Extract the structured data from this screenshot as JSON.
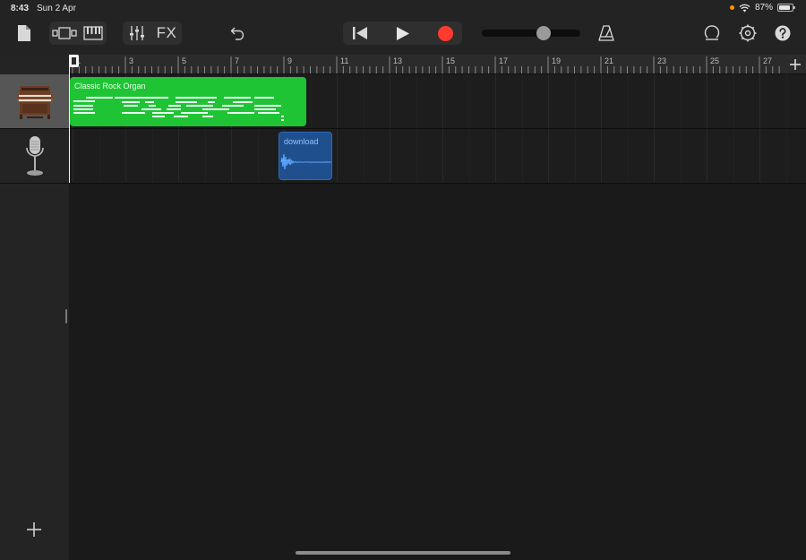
{
  "status_bar": {
    "time": "8:43",
    "date": "Sun 2 Apr",
    "battery": "87%",
    "battery_level": 0.87
  },
  "toolbar": {
    "fx_label": "FX",
    "icons": [
      "document-icon",
      "track-view-icon",
      "keyboard-icon",
      "mixer-icon",
      "undo-icon",
      "go-to-beginning-icon",
      "play-icon",
      "record-icon",
      "metronome-icon",
      "loop-browser-icon",
      "settings-icon",
      "help-icon"
    ],
    "tempo_slider_value": 0.65,
    "record_color": "#ff3b30"
  },
  "ruler": {
    "bar_labels": [
      "1",
      "3",
      "5",
      "7",
      "9",
      "11",
      "13",
      "15",
      "17",
      "19",
      "21",
      "23",
      "25",
      "27"
    ]
  },
  "tracks": [
    {
      "instrument": "organ",
      "icon": "organ-icon",
      "selected": true,
      "region": {
        "label": "Classic Rock Organ",
        "type": "midi",
        "color": "#1fc435"
      }
    },
    {
      "instrument": "microphone",
      "icon": "microphone-icon",
      "selected": false,
      "region": {
        "label": "download",
        "type": "audio",
        "color": "#1f4f8c"
      }
    }
  ],
  "colors": {
    "accent_green": "#1fc435",
    "audio_blue": "#2d6bb7",
    "background": "#1a1a1a"
  }
}
